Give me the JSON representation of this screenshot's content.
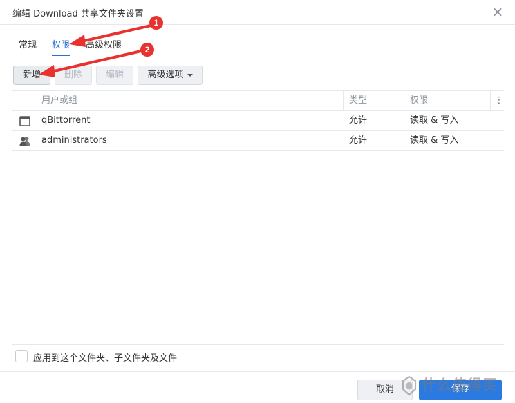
{
  "dialog": {
    "title": "编辑 Download 共享文件夹设置",
    "close_glyph": "×"
  },
  "tabs": [
    {
      "label": "常规",
      "active": false
    },
    {
      "label": "权限",
      "active": true
    },
    {
      "label": "高级权限",
      "active": false
    }
  ],
  "toolbar": {
    "add_label": "新增",
    "delete_label": "删除",
    "edit_label": "编辑",
    "advanced_label": "高级选项"
  },
  "table": {
    "columns": [
      "用户或组",
      "类型",
      "权限"
    ],
    "menu_glyph": "⋮",
    "rows": [
      {
        "icon": "app-window-icon",
        "name": "qBittorrent",
        "type": "允许",
        "permission": "读取 & 写入"
      },
      {
        "icon": "user-group-icon",
        "name": "administrators",
        "type": "允许",
        "permission": "读取 & 写入"
      }
    ]
  },
  "apply": {
    "label": "应用到这个文件夹、子文件夹及文件",
    "checked": false
  },
  "footer": {
    "cancel_label": "取消",
    "save_label": "保存",
    "watermark": "什么值得买"
  },
  "annotations": [
    {
      "number": "1"
    },
    {
      "number": "2"
    }
  ],
  "colors": {
    "accent": "#2a6ed6",
    "primary_button": "#2a7ae2",
    "annotation": "#e8322f"
  }
}
